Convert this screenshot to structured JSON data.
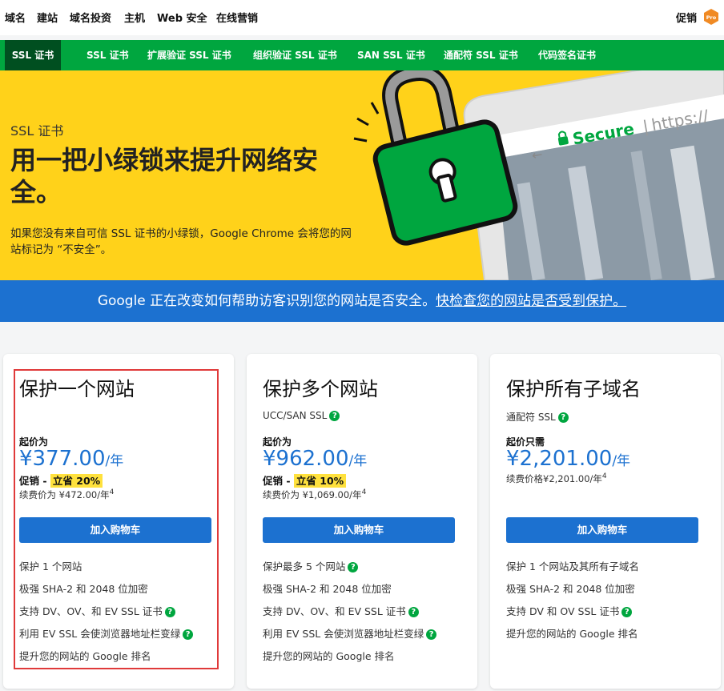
{
  "topnav": {
    "items": [
      "域名",
      "建站",
      "域名投资",
      "主机",
      "Web 安全",
      "在线营销"
    ],
    "promo": "促销",
    "pro_badge": "Pro"
  },
  "greenbar": {
    "current": "SSL 证书",
    "tabs": [
      "SSL 证书",
      "扩展验证 SSL 证书",
      "组织验证 SSL 证书",
      "SAN SSL 证书",
      "通配符 SSL 证书",
      "代码签名证书"
    ]
  },
  "hero": {
    "eyebrow": "SSL 证书",
    "title": "用一把小绿锁来提升网络安全。",
    "desc": "如果您没有来自可信 SSL 证书的小绿锁，Google Chrome 会将您的网站标记为 “不安全”。",
    "browser_secure": "Secure",
    "browser_url": "https://"
  },
  "banner": {
    "text": "Google 正在改变如何帮助访客识别您的网站是否安全。",
    "link": "快检查您的网站是否受到保护。"
  },
  "cards": [
    {
      "title": "保护一个网站",
      "subtitle": "",
      "from": "起价为",
      "price": "¥377.00",
      "unit": "/年",
      "promo_label": "促销 - ",
      "promo_value": "立省 20%",
      "renew": "续费价为 ¥472.00/年",
      "renew_sup": "4",
      "cart": "加入购物车",
      "features": [
        "保护 1 个网站",
        "极强 SHA-2 和 2048 位加密",
        "支持 DV、OV、和 EV SSL 证书",
        "利用 EV SSL 会使浏览器地址栏变绿",
        "提升您的网站的 Google 排名"
      ]
    },
    {
      "title": "保护多个网站",
      "subtitle": "UCC/SAN SSL",
      "from": "起价为",
      "price": "¥962.00",
      "unit": "/年",
      "promo_label": "促销 - ",
      "promo_value": "立省 10%",
      "renew": "续费价为 ¥1,069.00/年",
      "renew_sup": "4",
      "cart": "加入购物车",
      "features": [
        "保护最多 5 个网站",
        "极强 SHA-2 和 2048 位加密",
        "支持 DV、OV、和 EV SSL 证书",
        "利用 EV SSL 会使浏览器地址栏变绿",
        "提升您的网站的 Google 排名"
      ]
    },
    {
      "title": "保护所有子域名",
      "subtitle": "通配符 SSL",
      "from": "起价只需",
      "price": "¥2,201.00",
      "unit": "/年",
      "renew": "续费价格¥2,201.00/年",
      "renew_sup": "4",
      "cart": "加入购物车",
      "features": [
        "保护 1 个网站及其所有子域名",
        "极强 SHA-2 和 2048 位加密",
        "支持 DV 和 OV SSL 证书",
        "提升您的网站的 Google 排名"
      ]
    }
  ],
  "colors": {
    "green": "#00a63f",
    "dark_green": "#004f20",
    "yellow": "#ffd21a",
    "blue": "#1c71d0",
    "highlight": "#e03a3a"
  }
}
